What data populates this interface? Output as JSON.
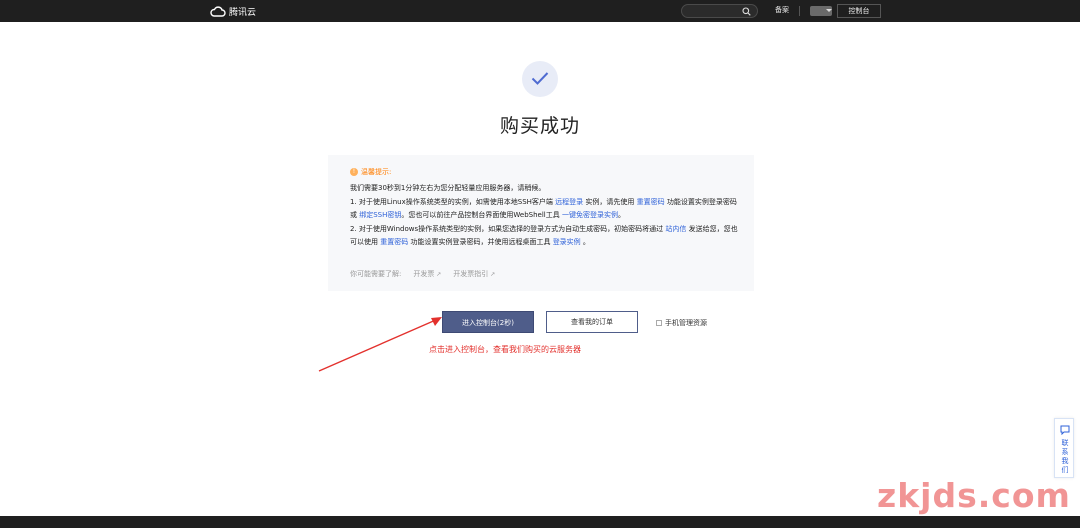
{
  "topbar": {
    "logo_text": "腾讯云",
    "nav_beian": "备案",
    "console_label": "控制台"
  },
  "main": {
    "title": "购买成功",
    "notice": {
      "tip_label": "温馨提示:",
      "line_intro": "我们需要30秒到1分钟左右为您分配轻量应用服务器，请稍候。",
      "line1_a": "1. 对于使用Linux操作系统类型的实例，如需使用本地SSH客户端 ",
      "line1_link1": "远程登录",
      "line1_b": " 实例，请先使用 ",
      "line1_link2": "重置密码",
      "line1_c": " 功能设置实例登录密码或 ",
      "line1_link3": "绑定SSH密钥",
      "line1_d": "。您也可以前往产品控制台界面使用WebShell工具 ",
      "line1_link4": "一键免密登录实例",
      "line1_e": "。",
      "line2_a": "2. 对于使用Windows操作系统类型的实例，如果您选择的登录方式为自动生成密码，初始密码将通过 ",
      "line2_link1": "站内信",
      "line2_b": " 发送给您，您也可以使用 ",
      "line2_link2": "重置密码",
      "line2_c": " 功能设置实例登录密码，并使用远程桌面工具 ",
      "line2_link3": "登录实例",
      "line2_d": " 。",
      "maybe_label": "你可能需要了解:",
      "maybe_links": [
        "开发票",
        "开发票指引"
      ]
    },
    "buttons": {
      "enter_console": "进入控制台(2秒)",
      "view_orders": "查看我的订单",
      "mobile_manage": "手机管理资源"
    },
    "annotation": "点击进入控制台，查看我们购买的云服务器"
  },
  "float": {
    "contact_label": "联系我们"
  },
  "watermark": "zkjds.com",
  "colors": {
    "primary_button": "#4f5d8a",
    "link": "#2e61d8",
    "tip": "#ff7d00",
    "annotation": "#e3312d",
    "topbar": "#1f1f1f"
  }
}
